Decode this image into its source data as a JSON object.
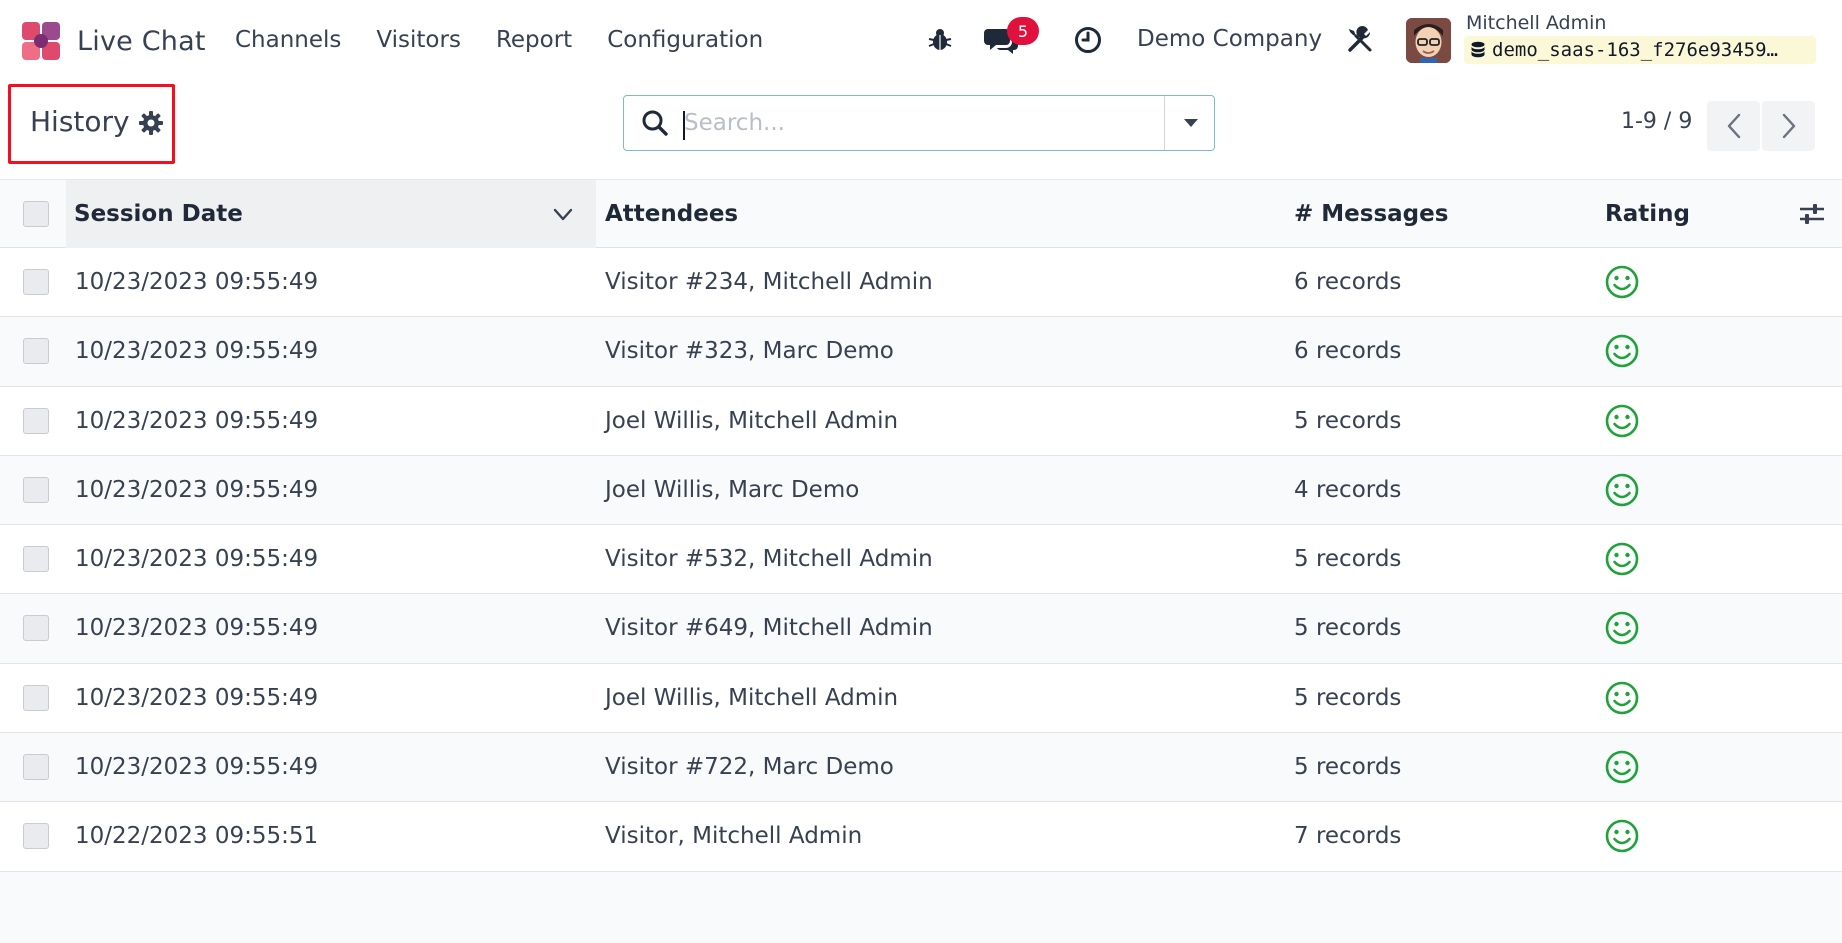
{
  "app": {
    "name": "Live Chat",
    "menu": [
      "Channels",
      "Visitors",
      "Report",
      "Configuration"
    ],
    "messages_badge": "5",
    "company": "Demo Company",
    "user": {
      "name": "Mitchell Admin",
      "database": "demo_saas-163_f276e93459…"
    }
  },
  "control": {
    "title": "History",
    "search_placeholder": "Search...",
    "pager": "1-9 / 9"
  },
  "table": {
    "columns": [
      "Session Date",
      "Attendees",
      "# Messages",
      "Rating"
    ],
    "rows": [
      {
        "date": "10/23/2023 09:55:49",
        "attendees": "Visitor #234, Mitchell Admin",
        "messages": "6 records",
        "rating": "smile"
      },
      {
        "date": "10/23/2023 09:55:49",
        "attendees": "Visitor #323, Marc Demo",
        "messages": "6 records",
        "rating": "smile"
      },
      {
        "date": "10/23/2023 09:55:49",
        "attendees": "Joel Willis, Mitchell Admin",
        "messages": "5 records",
        "rating": "smile"
      },
      {
        "date": "10/23/2023 09:55:49",
        "attendees": "Joel Willis, Marc Demo",
        "messages": "4 records",
        "rating": "smile"
      },
      {
        "date": "10/23/2023 09:55:49",
        "attendees": "Visitor #532, Mitchell Admin",
        "messages": "5 records",
        "rating": "smile"
      },
      {
        "date": "10/23/2023 09:55:49",
        "attendees": "Visitor #649, Mitchell Admin",
        "messages": "5 records",
        "rating": "smile"
      },
      {
        "date": "10/23/2023 09:55:49",
        "attendees": "Joel Willis, Mitchell Admin",
        "messages": "5 records",
        "rating": "smile"
      },
      {
        "date": "10/23/2023 09:55:49",
        "attendees": "Visitor #722, Marc Demo",
        "messages": "5 records",
        "rating": "smile"
      },
      {
        "date": "10/22/2023 09:55:51",
        "attendees": "Visitor, Mitchell Admin",
        "messages": "7 records",
        "rating": "smile"
      }
    ]
  },
  "colors": {
    "rating_green": "#1fa23a",
    "highlight_red": "#f30f1e",
    "badge_red": "#e0123d"
  }
}
